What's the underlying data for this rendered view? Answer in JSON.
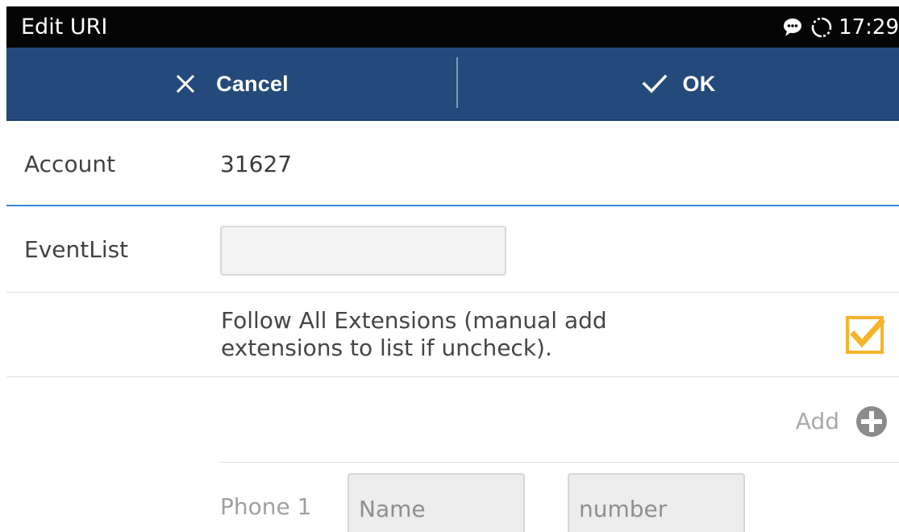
{
  "status_bar": {
    "title": "Edit URI",
    "time": "17:29",
    "icons": [
      "chat-bubble-icon",
      "sync-status-icon"
    ]
  },
  "toolbar": {
    "cancel_label": "Cancel",
    "cancel_icon": "close-icon",
    "ok_label": "OK",
    "ok_icon": "checkmark-icon"
  },
  "form": {
    "account": {
      "label": "Account",
      "value": "31627"
    },
    "eventlist": {
      "label": "EventList",
      "value": "",
      "placeholder": ""
    },
    "follow_all_extensions": {
      "label": "Follow All Extensions (manual add extensions to list if uncheck).",
      "checked": true
    },
    "add": {
      "label": "Add",
      "icon": "plus-circle-icon"
    },
    "phones": [
      {
        "label": "Phone 1",
        "name_placeholder": "Name",
        "number_placeholder": "number"
      }
    ]
  },
  "colors": {
    "toolbar_background": "#234a7a",
    "status_bar_background": "#050505",
    "accent_divider": "#3b86d6",
    "checkbox": "#f7b32b"
  }
}
